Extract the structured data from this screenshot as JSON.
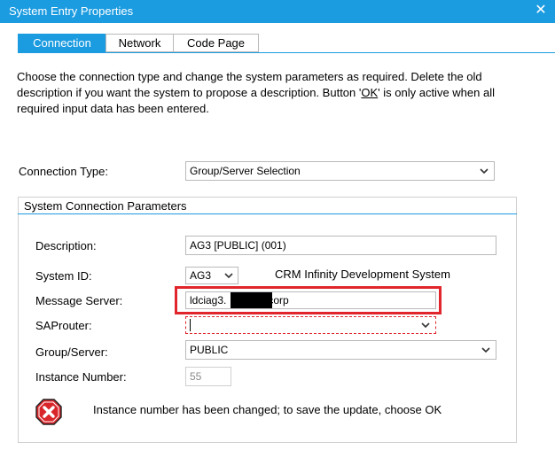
{
  "window": {
    "title": "System Entry Properties",
    "close": "✕"
  },
  "tabs": [
    {
      "label": "Connection",
      "active": true
    },
    {
      "label": "Network",
      "active": false
    },
    {
      "label": "Code Page",
      "active": false
    }
  ],
  "intro": {
    "text_1": "Choose the connection type and change the system parameters as required. Delete the old description if you want the system to propose a description. Button '",
    "ok": "OK",
    "text_2": "' is only active when all required input data has been entered."
  },
  "connection_type": {
    "label": "Connection Type:",
    "value": "Group/Server Selection"
  },
  "parameters": {
    "title": "System Connection Parameters",
    "description": {
      "label": "Description:",
      "value": "AG3 [PUBLIC] (001)"
    },
    "system_id": {
      "label": "System ID:",
      "value": "AG3",
      "system_name": "CRM Infinity Development System"
    },
    "message_server": {
      "label": "Message Server:",
      "value_prefix": "ldciag3.",
      "value_suffix": "corp"
    },
    "saprouter": {
      "label": "SAProuter:",
      "value": ""
    },
    "group_server": {
      "label": "Group/Server:",
      "value": "PUBLIC"
    },
    "instance_number": {
      "label": "Instance Number:",
      "value": "55"
    }
  },
  "status": {
    "message": "Instance number has been changed; to save the update, choose OK"
  },
  "colors": {
    "accent": "#1b9be0",
    "highlight": "#e0262c",
    "error_icon": "#d9262a"
  },
  "icons": {
    "close": "close-icon",
    "dropdown": "chevron-down-icon",
    "error": "error-icon"
  }
}
